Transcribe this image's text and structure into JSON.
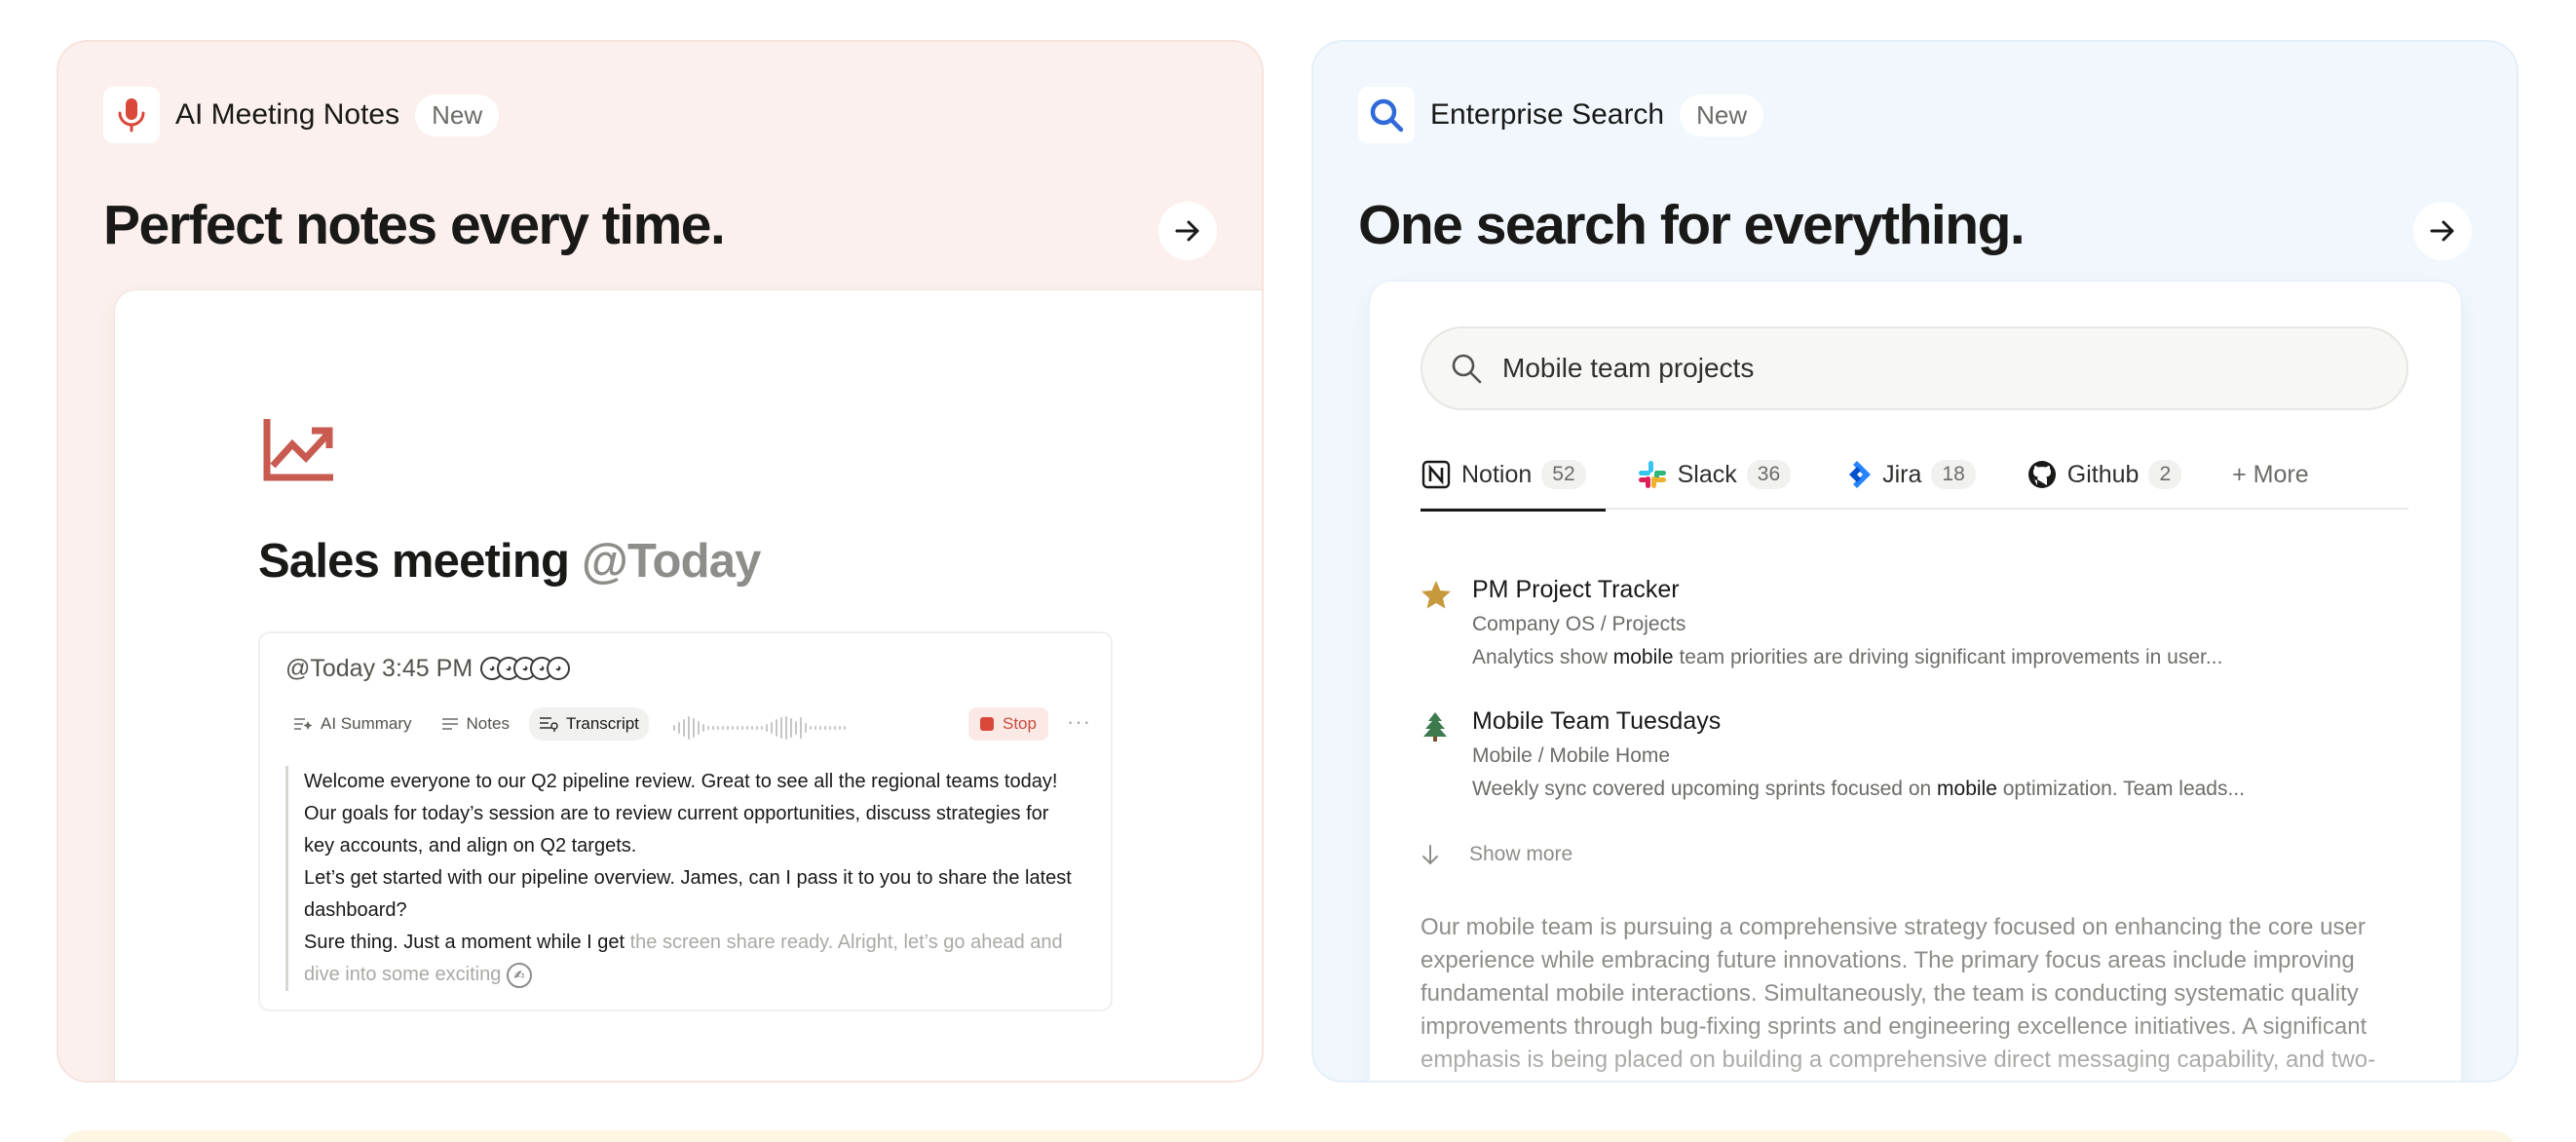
{
  "colors": {
    "left_card_bg": "#fbf0ed",
    "right_card_bg": "#f1f7fd",
    "meeting_accent": "#d9483b",
    "search_accent": "#2f6ad9",
    "bottom_card_bg": "#fdf6e3"
  },
  "meeting_card": {
    "icon": "microphone-icon",
    "label": "AI Meeting Notes",
    "badge": "New",
    "headline": "Perfect notes every time.",
    "arrow_icon": "arrow-right-icon",
    "page_icon": "trending-up-icon",
    "meeting_title": "Sales meeting",
    "meeting_date_mention": "@Today",
    "timestamp": "@Today 3:45 PM",
    "tabs": [
      {
        "label": "AI Summary",
        "icon": "ai-summary-icon"
      },
      {
        "label": "Notes",
        "icon": "notes-icon"
      },
      {
        "label": "Transcript",
        "icon": "transcript-icon",
        "active": true
      }
    ],
    "stop_label": "Stop",
    "transcript_lines": [
      "Welcome everyone to our Q2 pipeline review. Great to see all the regional teams today! Our goals for today’s session are to review current opportunities, discuss strategies for key accounts, and align on Q2 targets.",
      "Let’s get started with our pipeline overview. James, can I pass it to you to share the latest dashboard?"
    ],
    "transcript_partial": "Sure thing. Just a moment while I get",
    "transcript_pending": "the screen share ready. Alright, let’s go ahead and dive into some exciting"
  },
  "search_card": {
    "icon": "search-icon",
    "label": "Enterprise Search",
    "badge": "New",
    "headline": "One search for everything.",
    "arrow_icon": "arrow-right-icon",
    "query": "Mobile team projects",
    "sources": [
      {
        "name": "Notion",
        "count": "52",
        "icon": "notion-icon",
        "active": true
      },
      {
        "name": "Slack",
        "count": "36",
        "icon": "slack-icon"
      },
      {
        "name": "Jira",
        "count": "18",
        "icon": "jira-icon"
      },
      {
        "name": "Github",
        "count": "2",
        "icon": "github-icon"
      }
    ],
    "more_sources": "+ More",
    "results": [
      {
        "icon": "star-icon",
        "title": "PM Project Tracker",
        "path": "Company OS / Projects",
        "snippet_before": "Analytics show",
        "snippet_highlight": "mobile",
        "snippet_after": "team priorities are driving significant improvements in user..."
      },
      {
        "icon": "tree-icon",
        "title": "Mobile Team Tuesdays",
        "path": "Mobile / Mobile Home",
        "snippet_before": "Weekly sync covered upcoming sprints focused on",
        "snippet_highlight": "mobile",
        "snippet_after": "optimization. Team leads..."
      }
    ],
    "show_more": "Show more",
    "summary": "Our mobile team is pursuing a comprehensive strategy focused on enhancing the core user experience while embracing future innovations. The primary focus areas include improving fundamental mobile interactions. Simultaneously, the team is conducting systematic quality improvements through bug-fixing sprints and engineering excellence initiatives. A significant emphasis is being placed on building a comprehensive direct messaging capability, and two-"
  }
}
